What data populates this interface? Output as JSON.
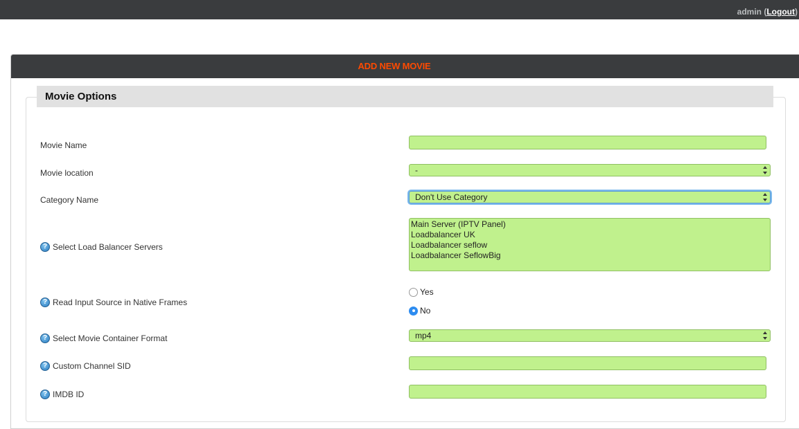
{
  "header": {
    "username": "admin",
    "logout_label": "Logout"
  },
  "panel": {
    "title": "ADD NEW MOVIE",
    "section_title": "Movie Options"
  },
  "form": {
    "movie_name": {
      "label": "Movie Name",
      "value": ""
    },
    "movie_location": {
      "label": "Movie location",
      "value": "-"
    },
    "category_name": {
      "label": "Category Name",
      "value": "Don't Use Category"
    },
    "load_balancer": {
      "label": "Select Load Balancer Servers",
      "options": [
        "Main Server (IPTV Panel)",
        "Loadbalancer UK",
        "Loadbalancer seflow",
        "Loadbalancer SeflowBig"
      ]
    },
    "native_frames": {
      "label": "Read Input Source in Native Frames",
      "options": [
        "Yes",
        "No"
      ],
      "selected": "No"
    },
    "container_format": {
      "label": "Select Movie Container Format",
      "value": "mp4"
    },
    "custom_sid": {
      "label": "Custom Channel SID",
      "value": ""
    },
    "imdb_id": {
      "label": "IMDB ID",
      "value": ""
    }
  },
  "colors": {
    "topbar": "#3a3c3e",
    "title_accent": "#ff4a00",
    "field_bg": "#c0f18d",
    "help_icon": "#2a7cc0"
  },
  "icons": {
    "help": "question-circle-icon",
    "select_arrows": "updown-arrows-icon"
  }
}
